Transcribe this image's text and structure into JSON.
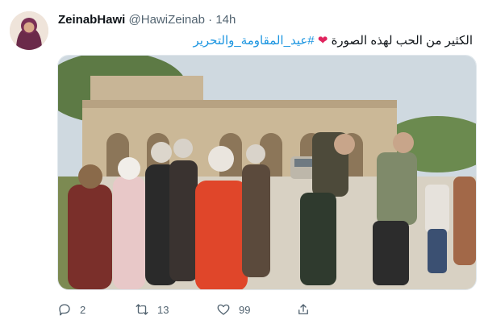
{
  "tweet": {
    "display_name": "ZeinabHawi",
    "handle": "@HawiZeinab",
    "separator": "·",
    "time": "14h",
    "text_main": "الكثير من الحب لهذه الصورة",
    "hashtag": "#عيد_المقاومة_والتحرير"
  },
  "actions": {
    "reply_count": "2",
    "retweet_count": "13",
    "like_count": "99"
  },
  "colors": {
    "hashtag": "#1b95e0",
    "heart": "#e0245e",
    "muted": "#536471"
  },
  "icons": [
    "avatar",
    "heart-emoji",
    "reply-icon",
    "retweet-icon",
    "like-icon",
    "share-icon"
  ]
}
